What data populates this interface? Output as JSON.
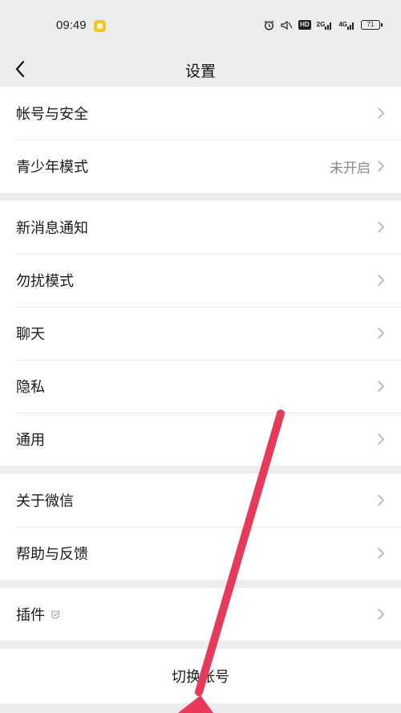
{
  "status_bar": {
    "time": "09:49",
    "network_1": "2G",
    "network_2": "4G",
    "battery": "71",
    "hd_label": "HD"
  },
  "nav": {
    "title": "设置"
  },
  "groups": {
    "account": {
      "account_security": "帐号与安全",
      "teen_mode": "青少年模式",
      "teen_mode_status": "未开启"
    },
    "notifications": {
      "new_message": "新消息通知",
      "do_not_disturb": "勿扰模式",
      "chat": "聊天",
      "privacy": "隐私",
      "general": "通用"
    },
    "about": {
      "about_wechat": "关于微信",
      "help_feedback": "帮助与反馈"
    },
    "plugins": {
      "plugins": "插件"
    }
  },
  "switch_account": "切换帐号",
  "colors": {
    "background": "#ededed",
    "row_background": "#ffffff",
    "annotation_arrow": "#e8395a"
  }
}
